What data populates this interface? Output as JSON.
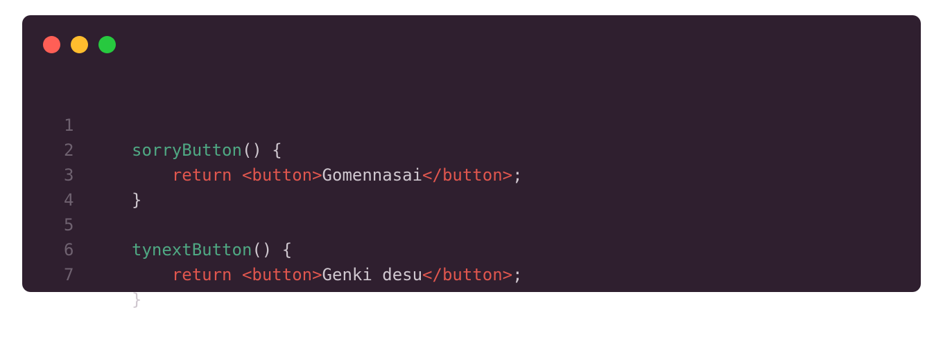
{
  "window": {
    "background": "#2f1f2f",
    "controls": [
      {
        "name": "close",
        "color": "#ff5f56"
      },
      {
        "name": "minimize",
        "color": "#ffbd2e"
      },
      {
        "name": "maximize",
        "color": "#27c93f"
      }
    ]
  },
  "colors": {
    "function": "#4fa883",
    "keyword": "#e0564e",
    "text": "#cfc7cf",
    "line_number": "#6f6270"
  },
  "code": {
    "lines": [
      {
        "number": "1",
        "indent": "",
        "fn": "sorryButton",
        "rest": "() {"
      },
      {
        "number": "2",
        "indent": "    ",
        "kw": "return",
        "open_tag": "<button>",
        "text": "Gomennasai",
        "close_tag": "</button>",
        "end": ";"
      },
      {
        "number": "3",
        "indent": "",
        "text": "}"
      },
      {
        "number": "4",
        "indent": "",
        "text": ""
      },
      {
        "number": "5",
        "indent": "",
        "fn": "tynextButton",
        "rest": "() {"
      },
      {
        "number": "6",
        "indent": "    ",
        "kw": "return",
        "open_tag": "<button>",
        "text": "Genki desu",
        "close_tag": "</button>",
        "end": ";"
      },
      {
        "number": "7",
        "indent": "",
        "text": "}"
      }
    ]
  }
}
